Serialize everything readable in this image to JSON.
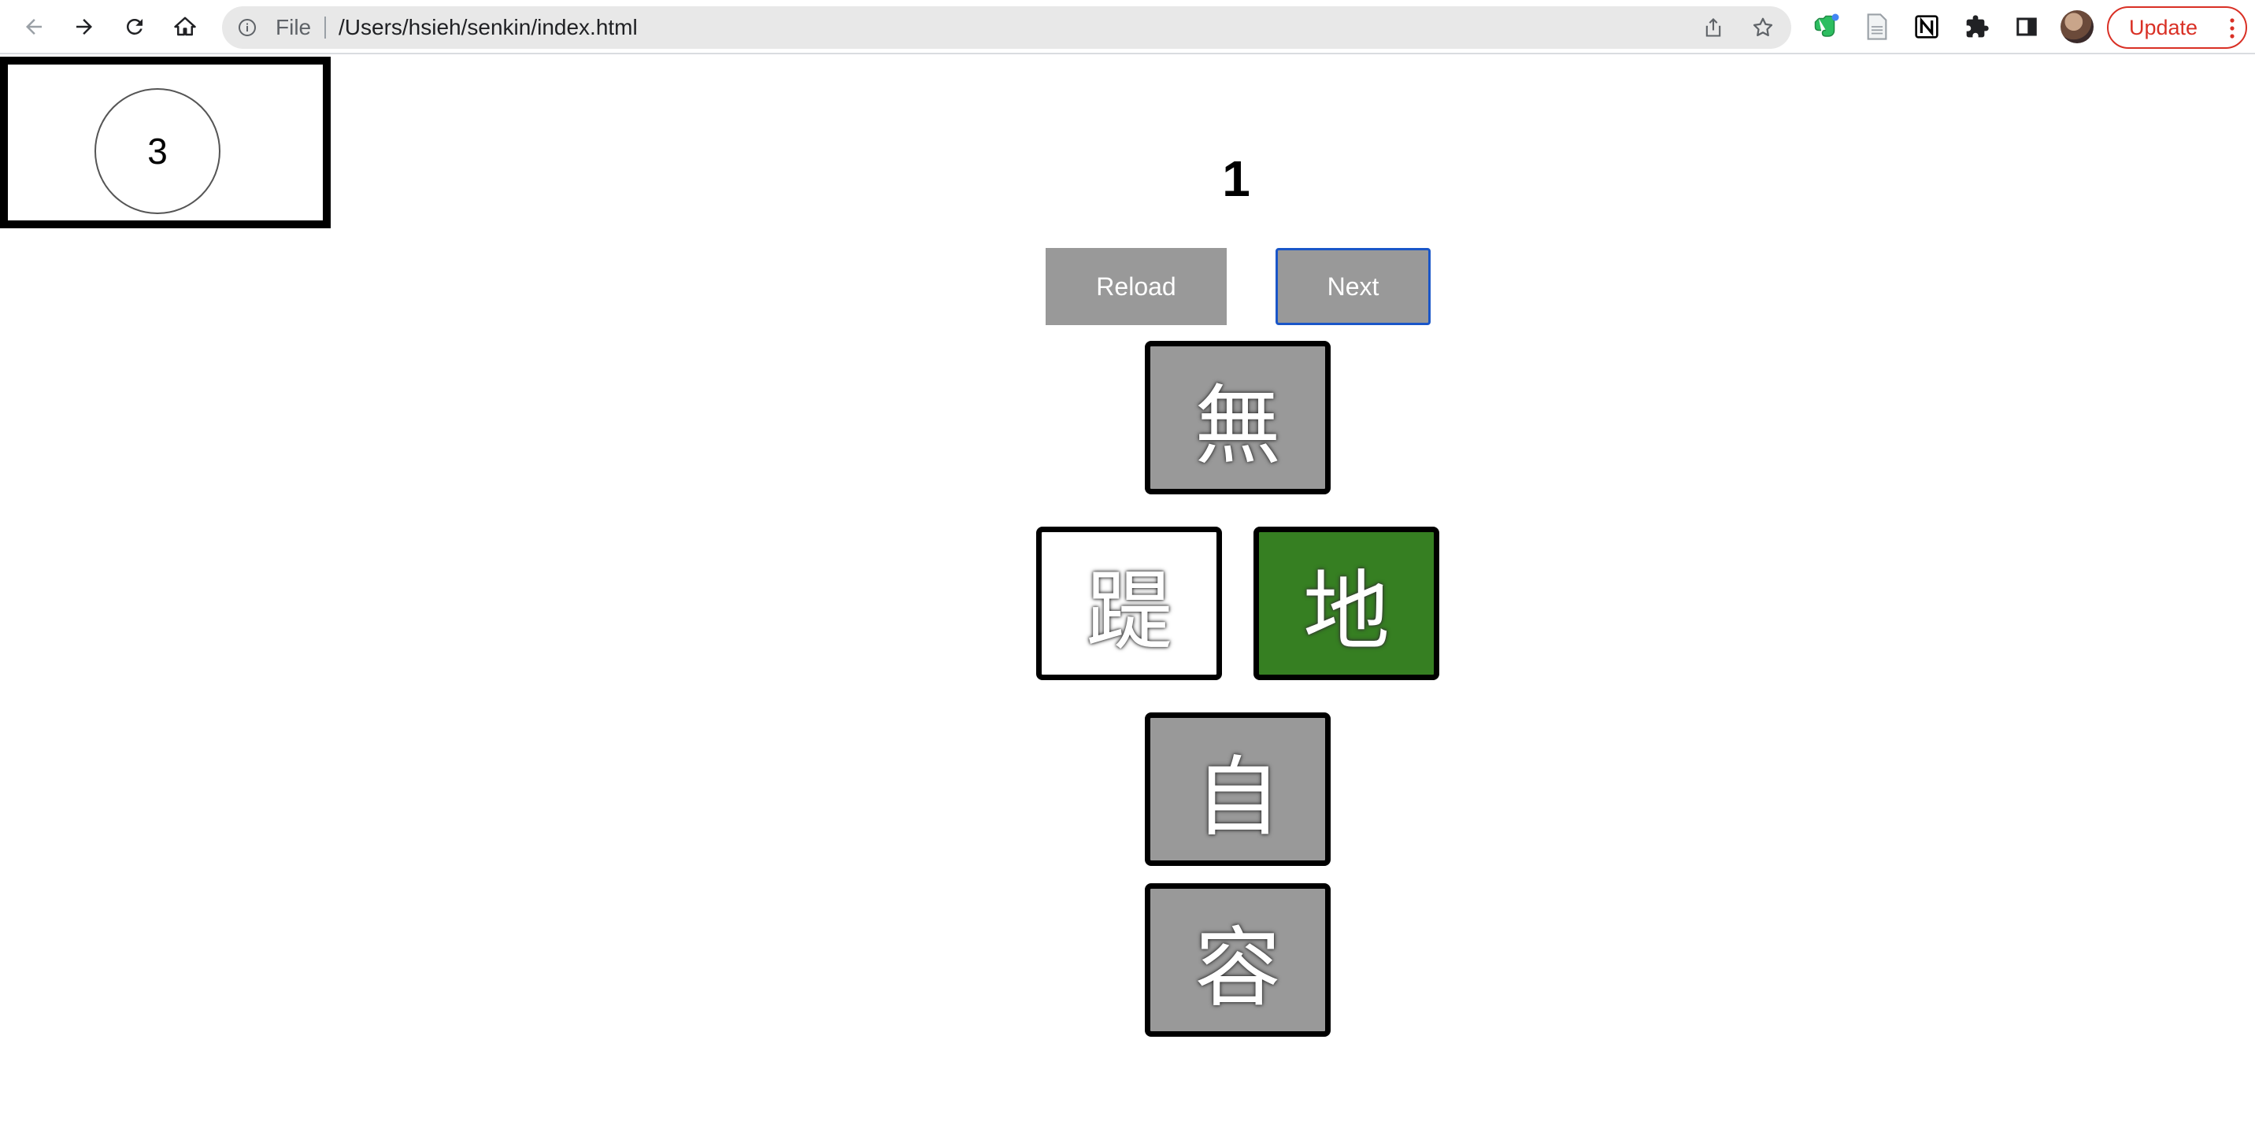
{
  "browser": {
    "scheme_label": "File",
    "url": "/Users/hsieh/senkin/index.html",
    "update_label": "Update",
    "icons": {
      "back": "arrow-left-icon",
      "forward": "arrow-right-icon",
      "reload": "reload-icon",
      "home": "home-icon",
      "info": "info-icon",
      "share": "share-icon",
      "bookmark": "star-icon",
      "ext1": "evernote-icon",
      "ext2": "document-icon",
      "ext3": "notion-icon",
      "ext4": "puzzle-icon",
      "ext5": "side-panel-icon",
      "menu": "kebab-menu-icon"
    },
    "colors": {
      "update": "#d93025",
      "omnibox": "#e8e8e8"
    }
  },
  "game": {
    "counter": "3",
    "round": "1",
    "reload_label": "Reload",
    "next_label": "Next",
    "tiles": {
      "top": "無",
      "left": "踶",
      "center": "地",
      "bottom1": "自",
      "bottom2": "容"
    },
    "colors": {
      "tile_default": "#999999",
      "tile_selected": "#367f22",
      "tile_blank": "#ffffff"
    }
  }
}
